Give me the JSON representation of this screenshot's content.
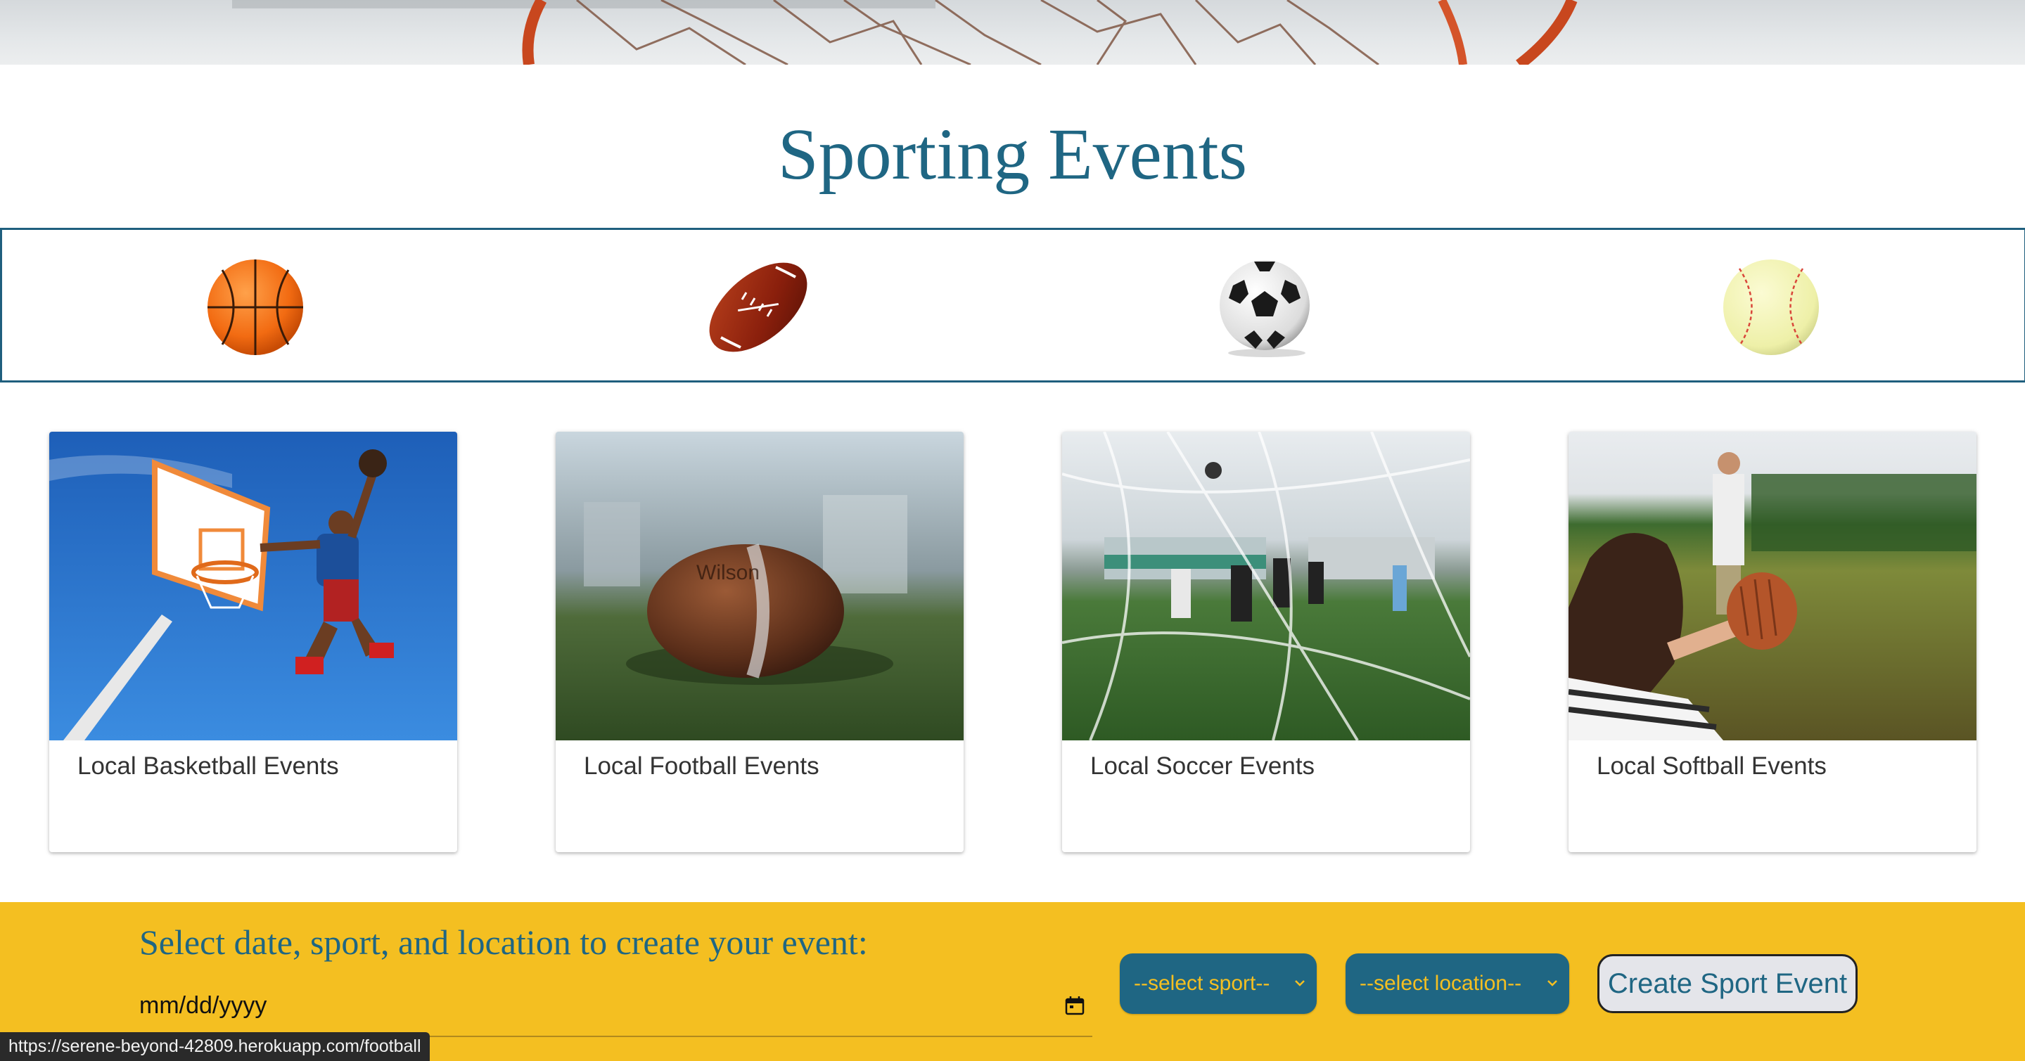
{
  "page": {
    "title": "Sporting Events"
  },
  "ball_nav": [
    {
      "sport": "basketball",
      "icon": "basketball-icon"
    },
    {
      "sport": "football",
      "icon": "football-icon"
    },
    {
      "sport": "soccer",
      "icon": "soccer-ball-icon"
    },
    {
      "sport": "softball",
      "icon": "softball-icon"
    }
  ],
  "cards": [
    {
      "label": "Local Basketball Events",
      "image": "basketball-dunk-photo"
    },
    {
      "label": "Local Football Events",
      "image": "football-on-turf-photo"
    },
    {
      "label": "Local Soccer Events",
      "image": "soccer-goal-net-photo"
    },
    {
      "label": "Local Softball Events",
      "image": "softball-catch-photo"
    }
  ],
  "create_form": {
    "prompt": "Select date, sport, and location to create your event:",
    "date_placeholder": "mm/dd/yyyy",
    "sport_select": "--select sport--",
    "location_select": "--select location--",
    "submit_label": "Create Sport Event"
  },
  "status_bar": {
    "url": "https://serene-beyond-42809.herokuapp.com/football"
  },
  "colors": {
    "title_blue": "#1f6683",
    "bar_yellow": "#f4bf21",
    "strip_border": "#1f5f7e"
  }
}
